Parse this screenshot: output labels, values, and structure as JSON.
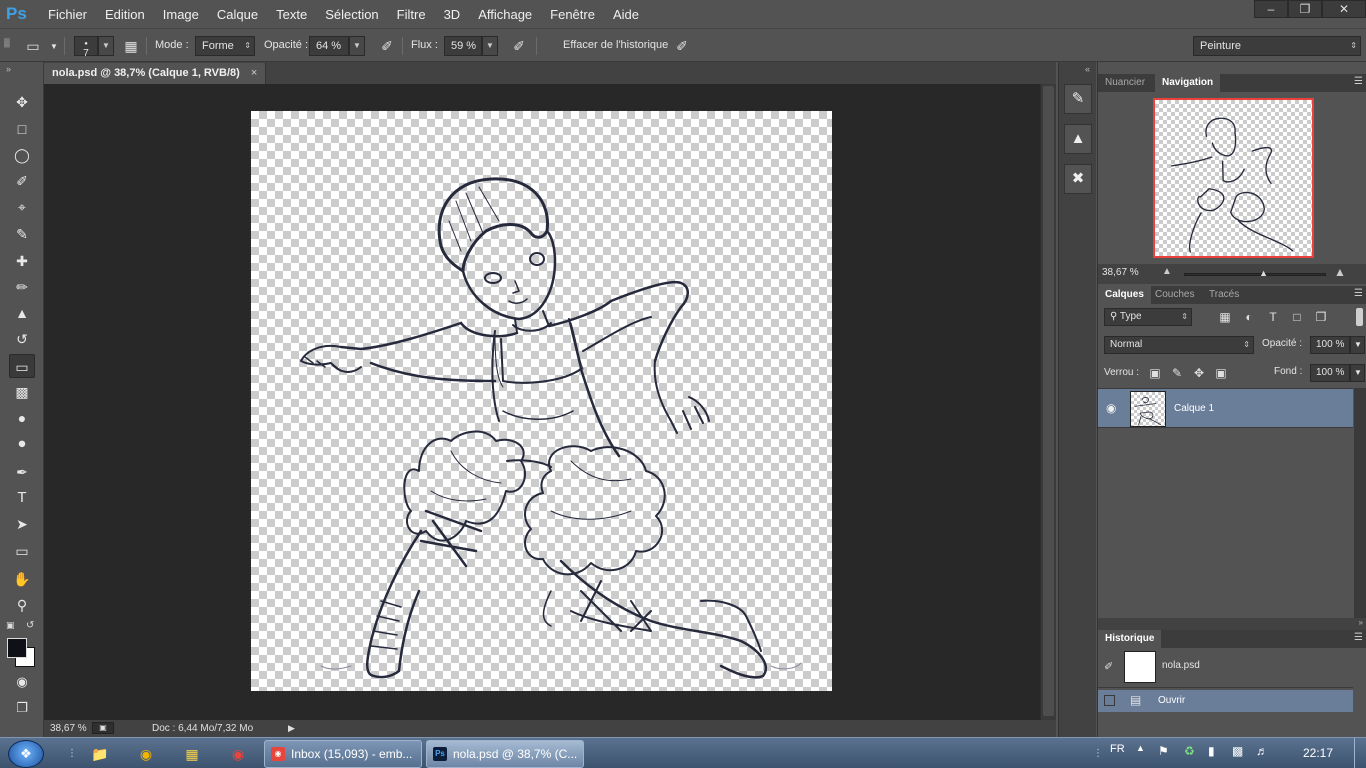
{
  "app": {
    "logo": "Ps",
    "menu": [
      "Fichier",
      "Edition",
      "Image",
      "Calque",
      "Texte",
      "Sélection",
      "Filtre",
      "3D",
      "Affichage",
      "Fenêtre",
      "Aide"
    ],
    "window_controls": [
      "minimize-icon",
      "restore-icon",
      "close-icon"
    ]
  },
  "options_bar": {
    "tool_icon": "eraser-icon",
    "brush_size": "7",
    "mode_label": "Mode :",
    "mode_value": "Forme",
    "opacity_label": "Opacité :",
    "opacity_value": "64 %",
    "flux_label": "Flux :",
    "flux_value": "59 %",
    "history_label": "Effacer de l'historique",
    "history_checked": false,
    "workspace": "Peinture"
  },
  "tools": [
    "move-icon",
    "marquee-icon",
    "lasso-icon",
    "quick-selection-icon",
    "crop-icon",
    "eyedropper-icon",
    "healing-icon",
    "brush-icon",
    "stamp-icon",
    "history-brush-icon",
    "eraser-icon",
    "gradient-icon",
    "blur-icon",
    "dodge-icon",
    "pen-icon",
    "type-icon",
    "path-selection-icon",
    "rectangle-icon",
    "hand-icon",
    "zoom-icon"
  ],
  "document": {
    "tab_title": "nola.psd @ 38,7% (Calque 1, RVB/8)",
    "zoom": "38,67 %",
    "doc_info": "Doc : 6,44 Mo/7,32 Mo"
  },
  "navigator": {
    "tabs": [
      "Nuancier",
      "Navigation"
    ],
    "active_tab": "Navigation",
    "zoom": "38,67 %",
    "zoom_slider_fraction": 0.55
  },
  "layers": {
    "tabs": [
      "Calques",
      "Couches",
      "Tracés"
    ],
    "active_tab": "Calques",
    "filter_type": "Type",
    "blend_mode": "Normal",
    "opacity_label": "Opacité :",
    "opacity_value": "100 %",
    "lock_label": "Verrou :",
    "fill_label": "Fond :",
    "fill_value": "100 %",
    "items": [
      {
        "name": "Calque 1",
        "visible": true,
        "selected": true
      }
    ]
  },
  "history": {
    "tab": "Historique",
    "snapshot": "nola.psd",
    "steps": [
      {
        "name": "Ouvrir",
        "selected": true
      }
    ]
  },
  "taskbar": {
    "tasks": [
      {
        "label": "Inbox (15,093) - emb...",
        "icon": "chrome-icon",
        "active": false
      },
      {
        "label": "nola.psd @ 38,7% (C...",
        "icon": "photoshop-icon",
        "active": true
      }
    ],
    "language": "FR",
    "time": "22:17"
  }
}
